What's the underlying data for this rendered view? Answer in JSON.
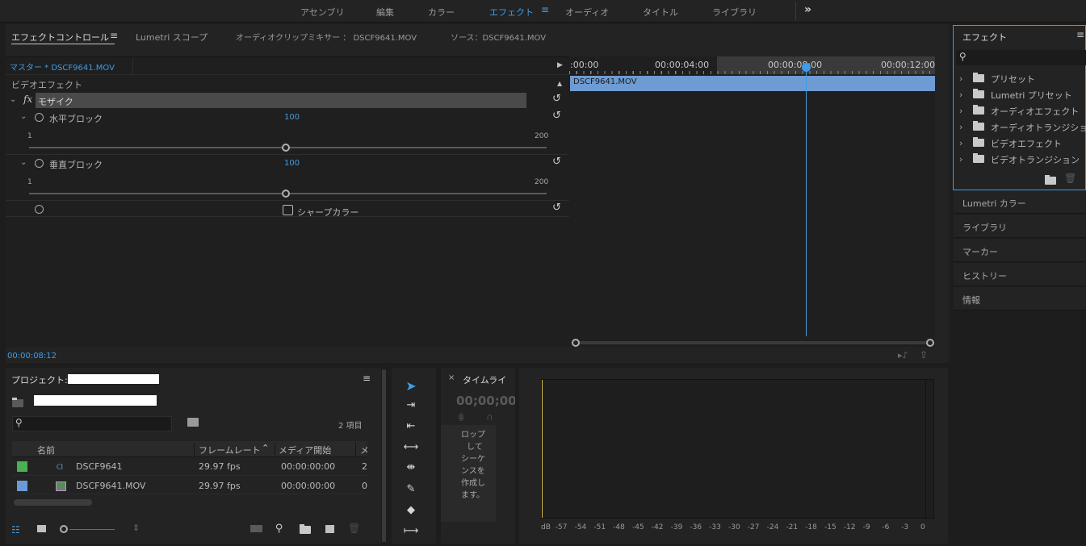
{
  "workspaces": {
    "items": [
      "アセンブリ",
      "編集",
      "カラー",
      "エフェクト",
      "オーディオ",
      "タイトル",
      "ライブラリ"
    ],
    "active": "エフェクト",
    "more": "»"
  },
  "effect_controls": {
    "tabs": {
      "effect_controls": "エフェクトコントロール",
      "lumetri_scope": "Lumetri スコープ",
      "audio_clip_mixer": "オーディオクリップミキサー ： DSCF9641.MOV",
      "source": "ソース：DSCF9641.MOV"
    },
    "master_label": "マスター * DSCF9641.MOV",
    "section_title": "ビデオエフェクト",
    "fx_symbol": "fx",
    "effect_name": "モザイク",
    "params": [
      {
        "label": "水平ブロック",
        "value": "100",
        "min": "1",
        "max": "200",
        "fraction": 0.5
      },
      {
        "label": "垂直ブロック",
        "value": "100",
        "min": "1",
        "max": "200",
        "fraction": 0.5
      }
    ],
    "checkbox_label": "シャープカラー",
    "timecode": "00:00:08:12"
  },
  "mini_timeline": {
    "ticks": [
      ":00:00",
      "00:00:04:00",
      "00:00:08:00",
      "00:00:12:00"
    ],
    "clip_name": "DSCF9641.MOV"
  },
  "effects_panel": {
    "title": "エフェクト",
    "tree": [
      "プリセット",
      "Lumetri プリセット",
      "オーディオエフェクト",
      "オーディオトランジション",
      "ビデオエフェクト",
      "ビデオトランジション"
    ]
  },
  "sidebar": {
    "items": [
      "Lumetri カラー",
      "ライブラリ",
      "マーカー",
      "ヒストリー",
      "情報"
    ]
  },
  "project": {
    "title": "プロジェクト:",
    "item_count": "2 項目",
    "columns": [
      "名前",
      "フレームレート",
      "メディア開始",
      "メ"
    ],
    "rows": [
      {
        "color": "#4caf50",
        "name": "DSCF9641",
        "fps": "29.97 fps",
        "start": "00:00:00:00",
        "extra": "2"
      },
      {
        "color": "#6a9bd8",
        "name": "DSCF9641.MOV",
        "fps": "29.97 fps",
        "start": "00:00:00:00",
        "extra": "0"
      }
    ]
  },
  "timeline": {
    "tab_label": "タイムライ",
    "timecode": "00;00;00;",
    "hint_lines": [
      "ロップ",
      "して",
      "シーケ",
      "ンスを",
      "作成し",
      "ます。"
    ]
  },
  "audio_meter": {
    "labels": [
      "dB",
      "-57",
      "-54",
      "-51",
      "-48",
      "-45",
      "-42",
      "-39",
      "-36",
      "-33",
      "-30",
      "-27",
      "-24",
      "-21",
      "-18",
      "-15",
      "-12",
      "-9",
      "-6",
      "-3",
      "0"
    ]
  },
  "colors": {
    "accent": "#3f9ce6",
    "clip": "#6d9bd2",
    "panel_bg": "#232323",
    "app_bg": "#1d1d1d"
  }
}
